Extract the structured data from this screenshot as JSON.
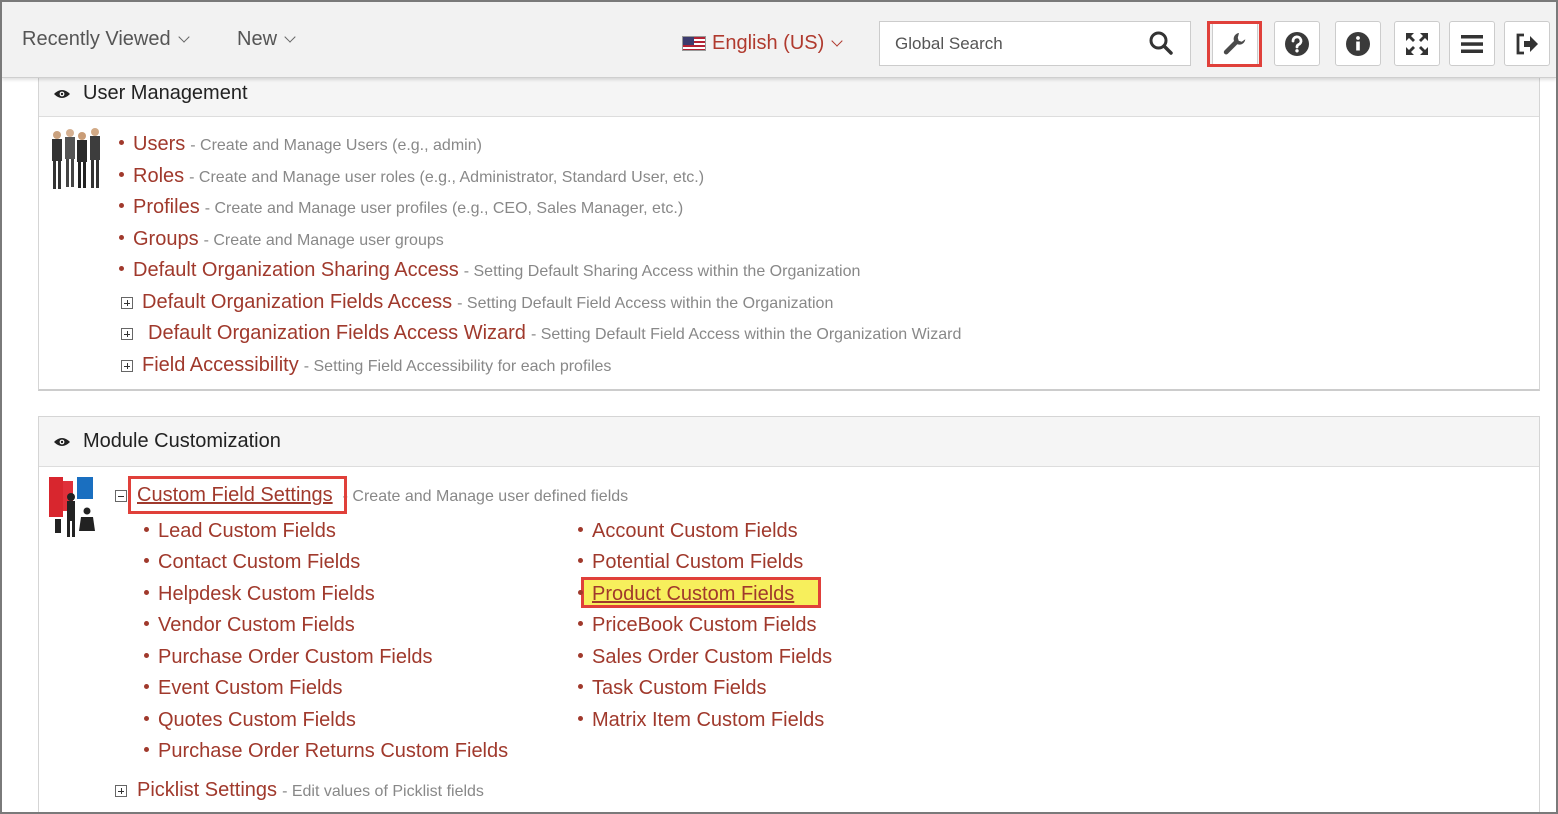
{
  "topbar": {
    "recently_viewed": "Recently Viewed",
    "new": "New",
    "language": "English (US)",
    "search_placeholder": "Global Search"
  },
  "user_management": {
    "title": "User Management",
    "items": [
      {
        "label": "Users",
        "desc": "- Create and Manage Users (e.g., admin)"
      },
      {
        "label": "Roles",
        "desc": "- Create and Manage user roles (e.g., Administrator, Standard User, etc.)"
      },
      {
        "label": "Profiles",
        "desc": "- Create and Manage user profiles (e.g., CEO, Sales Manager, etc.)"
      },
      {
        "label": "Groups",
        "desc": "- Create and Manage user groups"
      },
      {
        "label": "Default Organization Sharing Access",
        "desc": "- Setting Default Sharing Access within the Organization"
      },
      {
        "label": "Default Organization Fields Access",
        "desc": "- Setting Default Field Access within the Organization"
      },
      {
        "label": "Default Organization Fields Access Wizard",
        "desc": "- Setting Default Field Access within the Organization Wizard"
      },
      {
        "label": "Field Accessibility",
        "desc": "- Setting Field Accessibility for each profiles"
      }
    ]
  },
  "module_customization": {
    "title": "Module Customization",
    "custom_field_settings": {
      "label": "Custom Field Settings",
      "desc": "- Create and Manage user defined fields"
    },
    "left_col": [
      "Lead Custom Fields",
      "Contact Custom Fields",
      "Helpdesk Custom Fields",
      "Vendor Custom Fields",
      "Purchase Order Custom Fields",
      "Event Custom Fields",
      "Quotes Custom Fields",
      "Purchase Order Returns Custom Fields"
    ],
    "right_col": [
      "Account Custom Fields",
      "Potential Custom Fields",
      "Product Custom Fields",
      "PriceBook Custom Fields",
      "Sales Order Custom Fields",
      "Task Custom Fields",
      "Matrix Item Custom Fields"
    ],
    "picklist": {
      "label": "Picklist Settings",
      "desc": "- Edit values of Picklist fields"
    }
  },
  "colors": {
    "link": "#a0392c",
    "highlight_border": "#e0403a",
    "highlight_fill": "#f7ef5c"
  }
}
